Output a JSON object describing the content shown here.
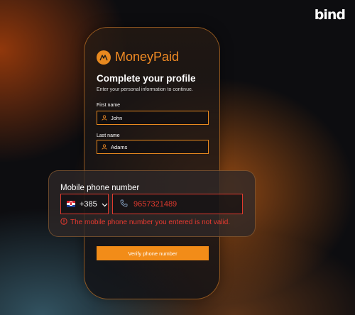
{
  "brand": {
    "mark": "bind"
  },
  "app": {
    "name": "MoneyPaid"
  },
  "profile": {
    "title": "Complete your profile",
    "subtitle": "Enter your personal information to continue.",
    "first_name": {
      "label": "First name",
      "value": "John"
    },
    "last_name": {
      "label": "Last name",
      "value": "Adams"
    }
  },
  "phone": {
    "label": "Mobile phone number",
    "country_code": "+385",
    "country": "croatia-flag-icon",
    "number": "9657321489",
    "error": "The mobile phone number you entered is not valid."
  },
  "actions": {
    "verify_label": "Verify phone number"
  },
  "colors": {
    "accent": "#f28c18",
    "error": "#e03a2e",
    "background": "#0d0d10"
  }
}
